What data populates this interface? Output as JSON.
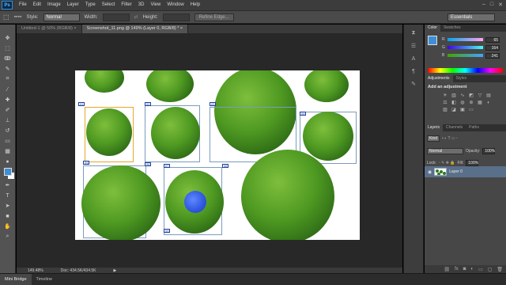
{
  "menubar": {
    "logo": "Ps",
    "items": [
      "File",
      "Edit",
      "Image",
      "Layer",
      "Type",
      "Select",
      "Filter",
      "3D",
      "View",
      "Window",
      "Help"
    ],
    "window_controls": [
      "–",
      "□",
      "✕"
    ]
  },
  "options": {
    "style_label": "Style:",
    "style_value": "Normal",
    "width_label": "Width:",
    "height_label": "Height:",
    "refine_button": "Refine Edge...",
    "workspace": "Essentials"
  },
  "tabs": [
    {
      "label": "Untitled-1 @ 50% (RGB/8) ×",
      "active": false
    },
    {
      "label": "Screenshot_11.png @ 149% (Layer 0, RGB/8) * ×",
      "active": true
    }
  ],
  "status": {
    "zoom": "149.48%",
    "doc": "Doc: 434.5K/434.5K"
  },
  "bottom_tabs": [
    "Mini Bridge",
    "Timeline"
  ],
  "color_panel": {
    "tabs": [
      "Color",
      "Swatches"
    ],
    "channels": [
      {
        "label": "R",
        "value": "65"
      },
      {
        "label": "G",
        "value": "164"
      },
      {
        "label": "B",
        "value": "241"
      }
    ],
    "foreground": "#3f8fd6"
  },
  "adjustments": {
    "tabs": [
      "Adjustments",
      "Styles"
    ],
    "title": "Add an adjustment"
  },
  "layers_panel": {
    "tabs": [
      "Layers",
      "Channels",
      "Paths"
    ],
    "kind_label": "Kind",
    "blend_mode": "Normal",
    "opacity_label": "Opacity:",
    "opacity_value": "100%",
    "lock_label": "Lock:",
    "fill_label": "Fill:",
    "fill_value": "100%",
    "layer_name": "Layer 0"
  },
  "canvas_tags": [
    "01",
    "02",
    "03",
    "04",
    "05",
    "06",
    "07",
    "08",
    "09",
    "10",
    "11"
  ]
}
